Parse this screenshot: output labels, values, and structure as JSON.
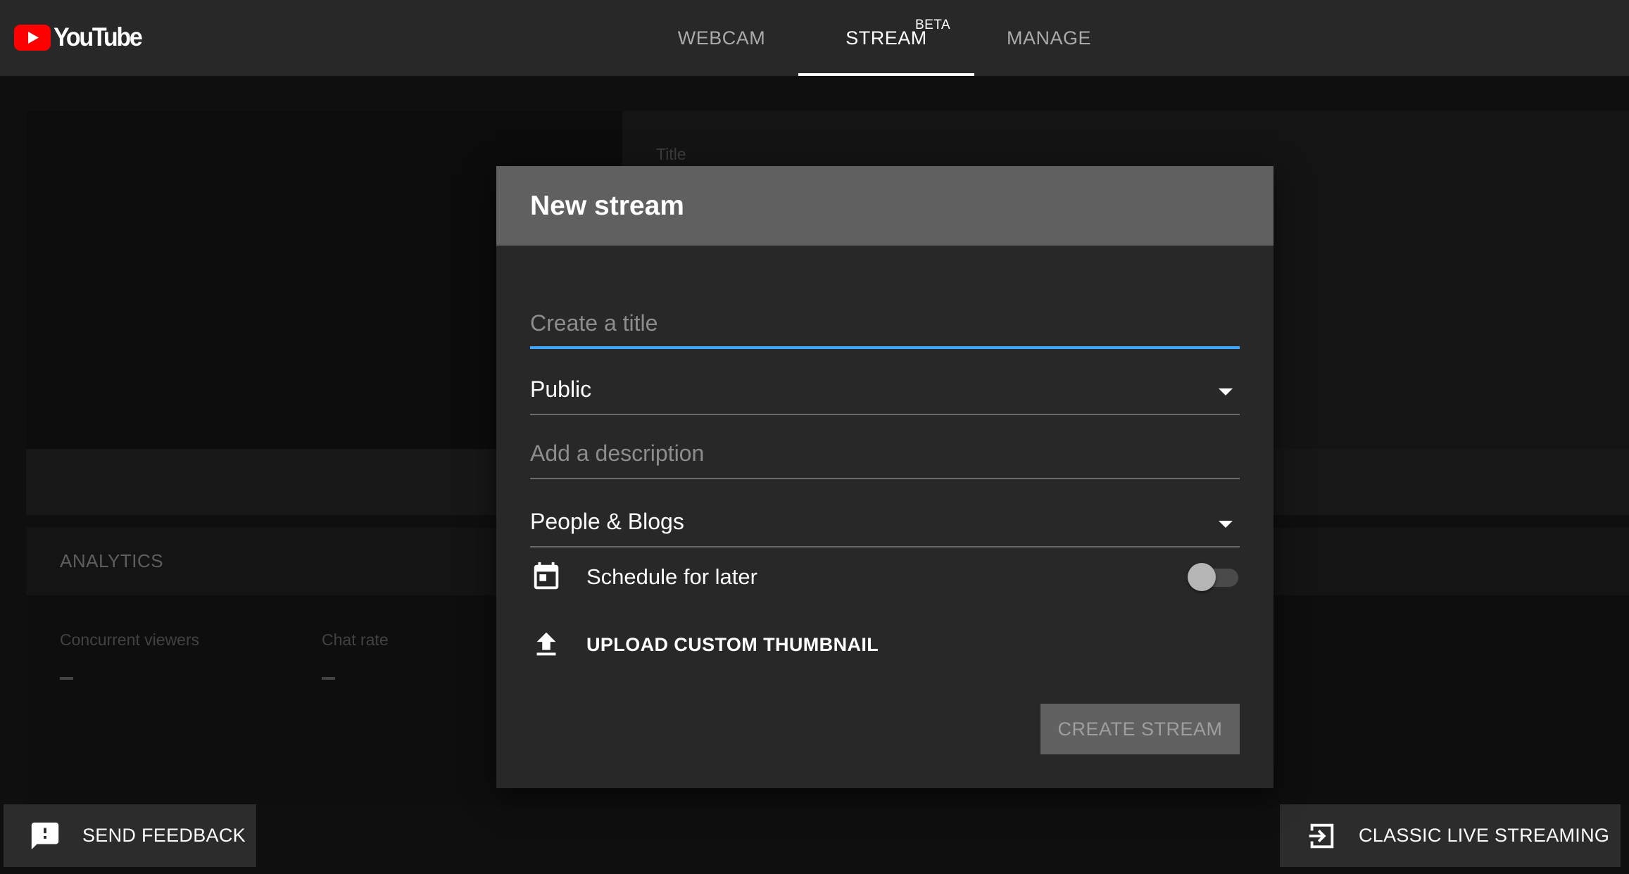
{
  "app": {
    "logo_text": "YouTube"
  },
  "nav": {
    "tabs": [
      {
        "label": "WEBCAM"
      },
      {
        "label": "STREAM",
        "badge": "BETA"
      },
      {
        "label": "MANAGE"
      }
    ]
  },
  "background": {
    "title_label": "Title",
    "analytics_label": "ANALYTICS",
    "metrics": [
      {
        "label": "Concurrent viewers",
        "value": "–"
      },
      {
        "label": "Chat rate",
        "value": "–"
      }
    ]
  },
  "modal": {
    "title": "New stream",
    "title_field": {
      "placeholder": "Create a title",
      "value": ""
    },
    "privacy_select": {
      "value": "Public"
    },
    "description_field": {
      "placeholder": "Add a description",
      "value": ""
    },
    "category_select": {
      "value": "People & Blogs"
    },
    "schedule_label": "Schedule for later",
    "schedule_enabled": false,
    "upload_label": "UPLOAD CUSTOM THUMBNAIL",
    "create_button": "CREATE STREAM"
  },
  "footer": {
    "feedback_label": "SEND FEEDBACK",
    "classic_label": "CLASSIC LIVE STREAMING"
  },
  "colors": {
    "brand_red": "#ff0000",
    "focus_blue": "#3ea6ff"
  }
}
